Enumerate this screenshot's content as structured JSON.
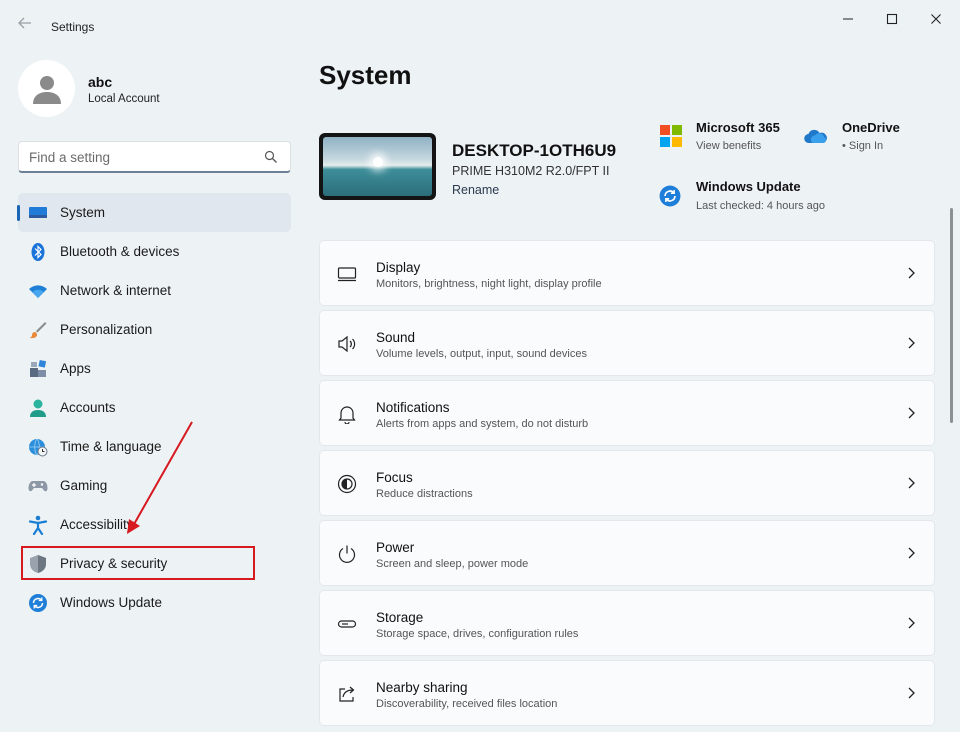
{
  "window": {
    "title": "Settings",
    "back_icon": "arrow-left-icon",
    "controls": [
      "minimize-icon",
      "maximize-icon",
      "close-icon"
    ]
  },
  "profile": {
    "name": "abc",
    "account_type": "Local Account"
  },
  "search": {
    "placeholder": "Find a setting",
    "value": ""
  },
  "sidebar": {
    "items": [
      {
        "label": "System",
        "icon": "monitor-icon",
        "active": true
      },
      {
        "label": "Bluetooth & devices",
        "icon": "bluetooth-icon",
        "active": false
      },
      {
        "label": "Network & internet",
        "icon": "wifi-icon",
        "active": false
      },
      {
        "label": "Personalization",
        "icon": "paintbrush-icon",
        "active": false
      },
      {
        "label": "Apps",
        "icon": "apps-icon",
        "active": false
      },
      {
        "label": "Accounts",
        "icon": "person-icon",
        "active": false
      },
      {
        "label": "Time & language",
        "icon": "globe-clock-icon",
        "active": false
      },
      {
        "label": "Gaming",
        "icon": "gamepad-icon",
        "active": false
      },
      {
        "label": "Accessibility",
        "icon": "accessibility-icon",
        "active": false
      },
      {
        "label": "Privacy & security",
        "icon": "shield-icon",
        "active": false
      },
      {
        "label": "Windows Update",
        "icon": "update-icon",
        "active": false
      }
    ]
  },
  "main": {
    "title": "System",
    "device": {
      "name": "DESKTOP-1OTH6U9",
      "model": "PRIME H310M2 R2.0/FPT II",
      "rename": "Rename"
    },
    "quick_links": {
      "microsoft365": {
        "title": "Microsoft 365",
        "sub": "View benefits"
      },
      "onedrive": {
        "title": "OneDrive",
        "sub": "• Sign In"
      },
      "windows_update": {
        "title": "Windows Update",
        "sub": "Last checked: 4 hours ago"
      }
    },
    "cards": [
      {
        "title": "Display",
        "sub": "Monitors, brightness, night light, display profile",
        "icon": "display-icon"
      },
      {
        "title": "Sound",
        "sub": "Volume levels, output, input, sound devices",
        "icon": "speaker-icon"
      },
      {
        "title": "Notifications",
        "sub": "Alerts from apps and system, do not disturb",
        "icon": "bell-icon"
      },
      {
        "title": "Focus",
        "sub": "Reduce distractions",
        "icon": "focus-icon"
      },
      {
        "title": "Power",
        "sub": "Screen and sleep, power mode",
        "icon": "power-icon"
      },
      {
        "title": "Storage",
        "sub": "Storage space, drives, configuration rules",
        "icon": "storage-icon"
      },
      {
        "title": "Nearby sharing",
        "sub": "Discoverability, received files location",
        "icon": "share-icon"
      }
    ]
  },
  "colors": {
    "accent": "#1a66b5",
    "annotation_red": "#d71920",
    "background": "#edf2f5"
  }
}
